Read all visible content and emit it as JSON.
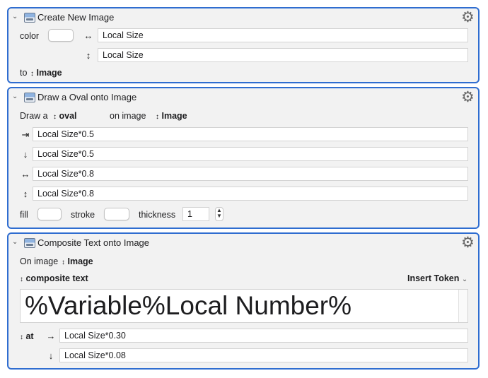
{
  "action1": {
    "title": "Create New Image",
    "color_label": "color",
    "width_value": "Local Size",
    "height_value": "Local Size",
    "to_label": "to",
    "to_value": "Image"
  },
  "action2": {
    "title": "Draw a Oval onto Image",
    "draw_label": "Draw a",
    "shape_value": "oval",
    "on_image_label": "on image",
    "image_value": "Image",
    "x_value": "Local Size*0.5",
    "y_value": "Local Size*0.5",
    "width_value": "Local Size*0.8",
    "height_value": "Local Size*0.8",
    "fill_label": "fill",
    "stroke_label": "stroke",
    "thickness_label": "thickness",
    "thickness_value": "1"
  },
  "action3": {
    "title": "Composite Text onto Image",
    "on_image_label": "On image",
    "image_value": "Image",
    "composite_text_label": "composite text",
    "insert_token_label": "Insert Token",
    "text_value": "%Variable%Local Number%",
    "at_label": "at",
    "x_value": "Local Size*0.30",
    "y_value": "Local Size*0.08"
  },
  "colors": {
    "accent_border": "#2f6dd0",
    "panel_background": "#f2f2f2"
  }
}
